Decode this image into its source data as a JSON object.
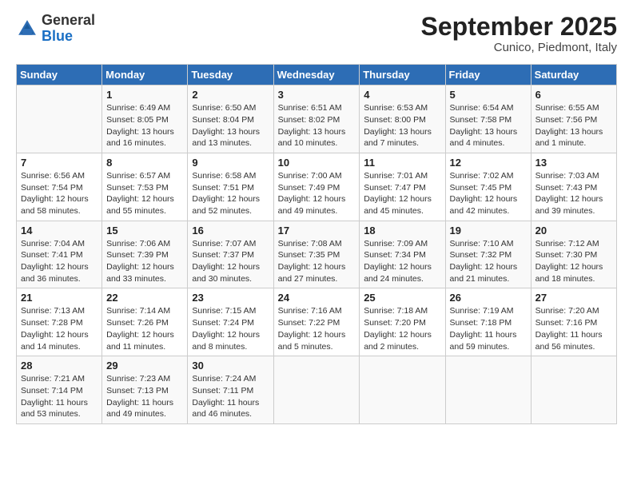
{
  "header": {
    "logo_line1": "General",
    "logo_line2": "Blue",
    "month_year": "September 2025",
    "location": "Cunico, Piedmont, Italy"
  },
  "weekdays": [
    "Sunday",
    "Monday",
    "Tuesday",
    "Wednesday",
    "Thursday",
    "Friday",
    "Saturday"
  ],
  "weeks": [
    [
      {
        "num": "",
        "sunrise": "",
        "sunset": "",
        "daylight": ""
      },
      {
        "num": "1",
        "sunrise": "Sunrise: 6:49 AM",
        "sunset": "Sunset: 8:05 PM",
        "daylight": "Daylight: 13 hours and 16 minutes."
      },
      {
        "num": "2",
        "sunrise": "Sunrise: 6:50 AM",
        "sunset": "Sunset: 8:04 PM",
        "daylight": "Daylight: 13 hours and 13 minutes."
      },
      {
        "num": "3",
        "sunrise": "Sunrise: 6:51 AM",
        "sunset": "Sunset: 8:02 PM",
        "daylight": "Daylight: 13 hours and 10 minutes."
      },
      {
        "num": "4",
        "sunrise": "Sunrise: 6:53 AM",
        "sunset": "Sunset: 8:00 PM",
        "daylight": "Daylight: 13 hours and 7 minutes."
      },
      {
        "num": "5",
        "sunrise": "Sunrise: 6:54 AM",
        "sunset": "Sunset: 7:58 PM",
        "daylight": "Daylight: 13 hours and 4 minutes."
      },
      {
        "num": "6",
        "sunrise": "Sunrise: 6:55 AM",
        "sunset": "Sunset: 7:56 PM",
        "daylight": "Daylight: 13 hours and 1 minute."
      }
    ],
    [
      {
        "num": "7",
        "sunrise": "Sunrise: 6:56 AM",
        "sunset": "Sunset: 7:54 PM",
        "daylight": "Daylight: 12 hours and 58 minutes."
      },
      {
        "num": "8",
        "sunrise": "Sunrise: 6:57 AM",
        "sunset": "Sunset: 7:53 PM",
        "daylight": "Daylight: 12 hours and 55 minutes."
      },
      {
        "num": "9",
        "sunrise": "Sunrise: 6:58 AM",
        "sunset": "Sunset: 7:51 PM",
        "daylight": "Daylight: 12 hours and 52 minutes."
      },
      {
        "num": "10",
        "sunrise": "Sunrise: 7:00 AM",
        "sunset": "Sunset: 7:49 PM",
        "daylight": "Daylight: 12 hours and 49 minutes."
      },
      {
        "num": "11",
        "sunrise": "Sunrise: 7:01 AM",
        "sunset": "Sunset: 7:47 PM",
        "daylight": "Daylight: 12 hours and 45 minutes."
      },
      {
        "num": "12",
        "sunrise": "Sunrise: 7:02 AM",
        "sunset": "Sunset: 7:45 PM",
        "daylight": "Daylight: 12 hours and 42 minutes."
      },
      {
        "num": "13",
        "sunrise": "Sunrise: 7:03 AM",
        "sunset": "Sunset: 7:43 PM",
        "daylight": "Daylight: 12 hours and 39 minutes."
      }
    ],
    [
      {
        "num": "14",
        "sunrise": "Sunrise: 7:04 AM",
        "sunset": "Sunset: 7:41 PM",
        "daylight": "Daylight: 12 hours and 36 minutes."
      },
      {
        "num": "15",
        "sunrise": "Sunrise: 7:06 AM",
        "sunset": "Sunset: 7:39 PM",
        "daylight": "Daylight: 12 hours and 33 minutes."
      },
      {
        "num": "16",
        "sunrise": "Sunrise: 7:07 AM",
        "sunset": "Sunset: 7:37 PM",
        "daylight": "Daylight: 12 hours and 30 minutes."
      },
      {
        "num": "17",
        "sunrise": "Sunrise: 7:08 AM",
        "sunset": "Sunset: 7:35 PM",
        "daylight": "Daylight: 12 hours and 27 minutes."
      },
      {
        "num": "18",
        "sunrise": "Sunrise: 7:09 AM",
        "sunset": "Sunset: 7:34 PM",
        "daylight": "Daylight: 12 hours and 24 minutes."
      },
      {
        "num": "19",
        "sunrise": "Sunrise: 7:10 AM",
        "sunset": "Sunset: 7:32 PM",
        "daylight": "Daylight: 12 hours and 21 minutes."
      },
      {
        "num": "20",
        "sunrise": "Sunrise: 7:12 AM",
        "sunset": "Sunset: 7:30 PM",
        "daylight": "Daylight: 12 hours and 18 minutes."
      }
    ],
    [
      {
        "num": "21",
        "sunrise": "Sunrise: 7:13 AM",
        "sunset": "Sunset: 7:28 PM",
        "daylight": "Daylight: 12 hours and 14 minutes."
      },
      {
        "num": "22",
        "sunrise": "Sunrise: 7:14 AM",
        "sunset": "Sunset: 7:26 PM",
        "daylight": "Daylight: 12 hours and 11 minutes."
      },
      {
        "num": "23",
        "sunrise": "Sunrise: 7:15 AM",
        "sunset": "Sunset: 7:24 PM",
        "daylight": "Daylight: 12 hours and 8 minutes."
      },
      {
        "num": "24",
        "sunrise": "Sunrise: 7:16 AM",
        "sunset": "Sunset: 7:22 PM",
        "daylight": "Daylight: 12 hours and 5 minutes."
      },
      {
        "num": "25",
        "sunrise": "Sunrise: 7:18 AM",
        "sunset": "Sunset: 7:20 PM",
        "daylight": "Daylight: 12 hours and 2 minutes."
      },
      {
        "num": "26",
        "sunrise": "Sunrise: 7:19 AM",
        "sunset": "Sunset: 7:18 PM",
        "daylight": "Daylight: 11 hours and 59 minutes."
      },
      {
        "num": "27",
        "sunrise": "Sunrise: 7:20 AM",
        "sunset": "Sunset: 7:16 PM",
        "daylight": "Daylight: 11 hours and 56 minutes."
      }
    ],
    [
      {
        "num": "28",
        "sunrise": "Sunrise: 7:21 AM",
        "sunset": "Sunset: 7:14 PM",
        "daylight": "Daylight: 11 hours and 53 minutes."
      },
      {
        "num": "29",
        "sunrise": "Sunrise: 7:23 AM",
        "sunset": "Sunset: 7:13 PM",
        "daylight": "Daylight: 11 hours and 49 minutes."
      },
      {
        "num": "30",
        "sunrise": "Sunrise: 7:24 AM",
        "sunset": "Sunset: 7:11 PM",
        "daylight": "Daylight: 11 hours and 46 minutes."
      },
      {
        "num": "",
        "sunrise": "",
        "sunset": "",
        "daylight": ""
      },
      {
        "num": "",
        "sunrise": "",
        "sunset": "",
        "daylight": ""
      },
      {
        "num": "",
        "sunrise": "",
        "sunset": "",
        "daylight": ""
      },
      {
        "num": "",
        "sunrise": "",
        "sunset": "",
        "daylight": ""
      }
    ]
  ]
}
